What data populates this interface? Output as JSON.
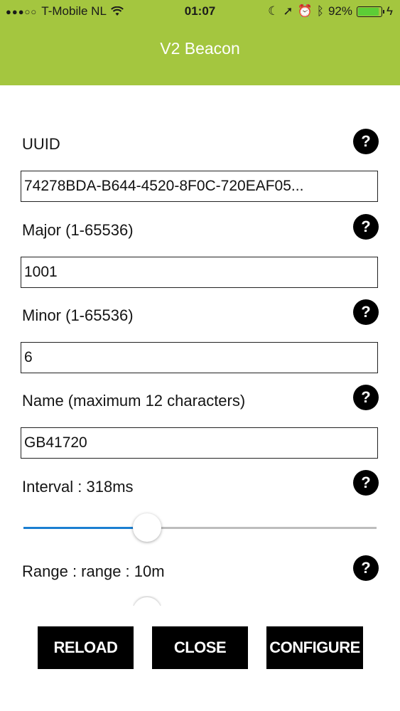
{
  "status": {
    "carrier": "T-Mobile NL",
    "time": "01:07",
    "battery": "92%",
    "battery_level": 92
  },
  "header": {
    "title": "V2 Beacon"
  },
  "form": {
    "uuid": {
      "label": "UUID",
      "value": "74278BDA-B644-4520-8F0C-720EAF05..."
    },
    "major": {
      "label": "Major (1-65536)",
      "value": "1001"
    },
    "minor": {
      "label": "Minor (1-65536)",
      "value": "6"
    },
    "name": {
      "label": "Name (maximum 12 characters)",
      "value": "GB41720"
    },
    "interval": {
      "label": "Interval : 318ms",
      "slider_fraction": 0.35
    },
    "range": {
      "label": "Range : range : 10m"
    },
    "help_glyph": "?"
  },
  "buttons": {
    "reload": "RELOAD",
    "close": "CLOSE",
    "configure": "CONFIGURE"
  },
  "colors": {
    "header": "#a4c63f",
    "slider_active": "#1b7fd1",
    "button": "#000000"
  }
}
